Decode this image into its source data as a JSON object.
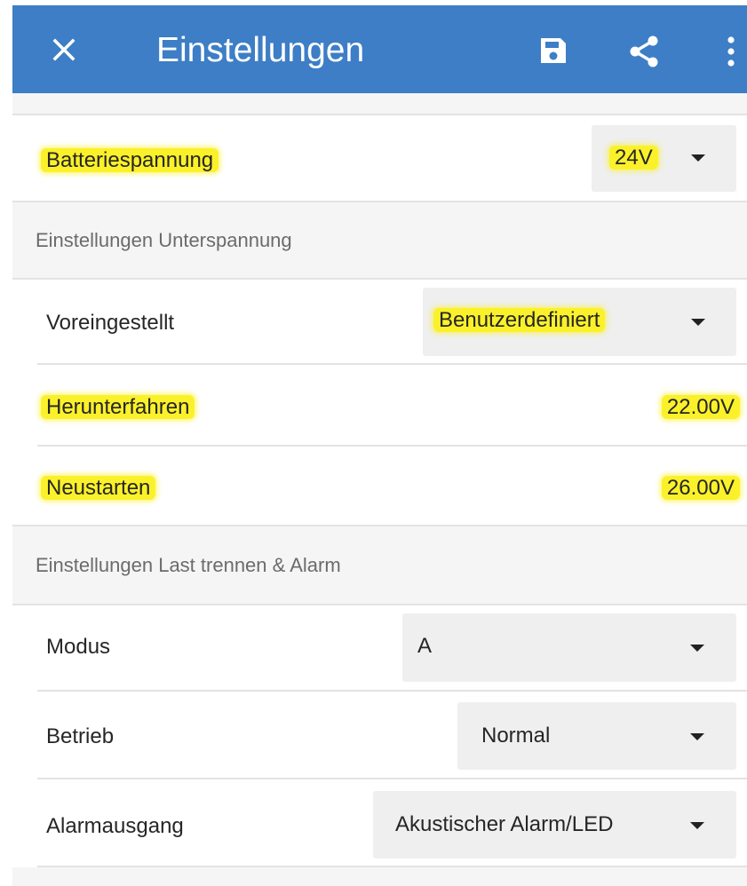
{
  "app": {
    "title": "Einstellungen",
    "bar_color": "#3d7ec6",
    "icons": [
      "close-icon",
      "save-icon",
      "share-icon",
      "more-vert-icon"
    ]
  },
  "battery": {
    "label": "Batteriespannung",
    "value": "24V",
    "highlighted": true
  },
  "undervoltage": {
    "section_title": "Einstellungen Unterspannung",
    "preset": {
      "label": "Voreingestellt",
      "value": "Benutzerdefiniert"
    },
    "shutdown": {
      "label": "Herunterfahren",
      "value": "22.00V"
    },
    "restart": {
      "label": "Neustarten",
      "value": "26.00V"
    }
  },
  "load_alarm": {
    "section_title": "Einstellungen Last trennen & Alarm",
    "mode": {
      "label": "Modus",
      "value": "A"
    },
    "operation": {
      "label": "Betrieb",
      "value": "Normal"
    },
    "alarm_output": {
      "label": "Alarmausgang",
      "value": "Akustischer Alarm/LED"
    }
  },
  "highlight_color": "#fbf12a"
}
